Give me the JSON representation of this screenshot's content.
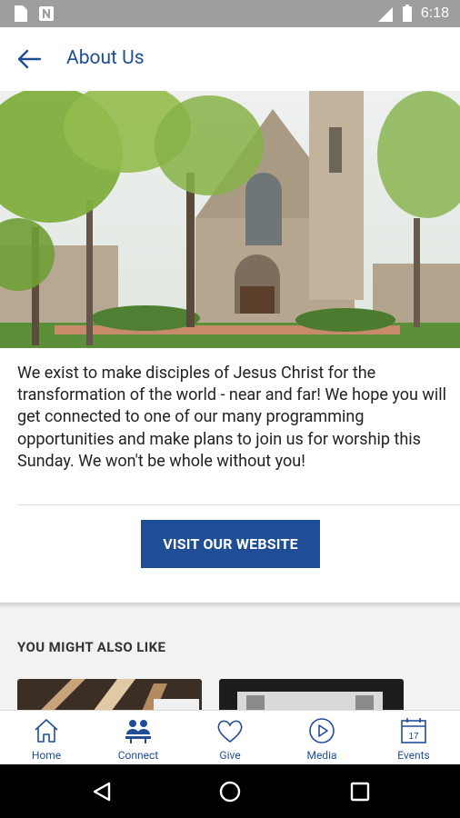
{
  "status_bar": {
    "time": "6:18",
    "icons": [
      "sd-card-icon",
      "n-notification-icon",
      "signal-icon",
      "battery-icon"
    ]
  },
  "app_bar": {
    "title": "About Us",
    "back_icon": "arrow-left-icon"
  },
  "hero": {
    "alt": "Church building"
  },
  "about": {
    "text": "We exist to make disciples of Jesus Christ for the transformation of the world - near and far! We hope you will get connected to one of our many programming opportunities and make plans to join us for worship this Sunday. We won't be whole without you!",
    "button_label": "VISIT OUR WEBSITE"
  },
  "also": {
    "title": "YOU MIGHT ALSO LIKE"
  },
  "bottom_nav": {
    "items": [
      {
        "label": "Home",
        "icon": "home-icon"
      },
      {
        "label": "Connect",
        "icon": "people-icon"
      },
      {
        "label": "Give",
        "icon": "heart-icon"
      },
      {
        "label": "Media",
        "icon": "play-icon"
      },
      {
        "label": "Events",
        "icon": "calendar-icon"
      }
    ]
  },
  "colors": {
    "brand": "#1f4e96",
    "text": "#222222",
    "status_bar": "#9e9e9e"
  }
}
